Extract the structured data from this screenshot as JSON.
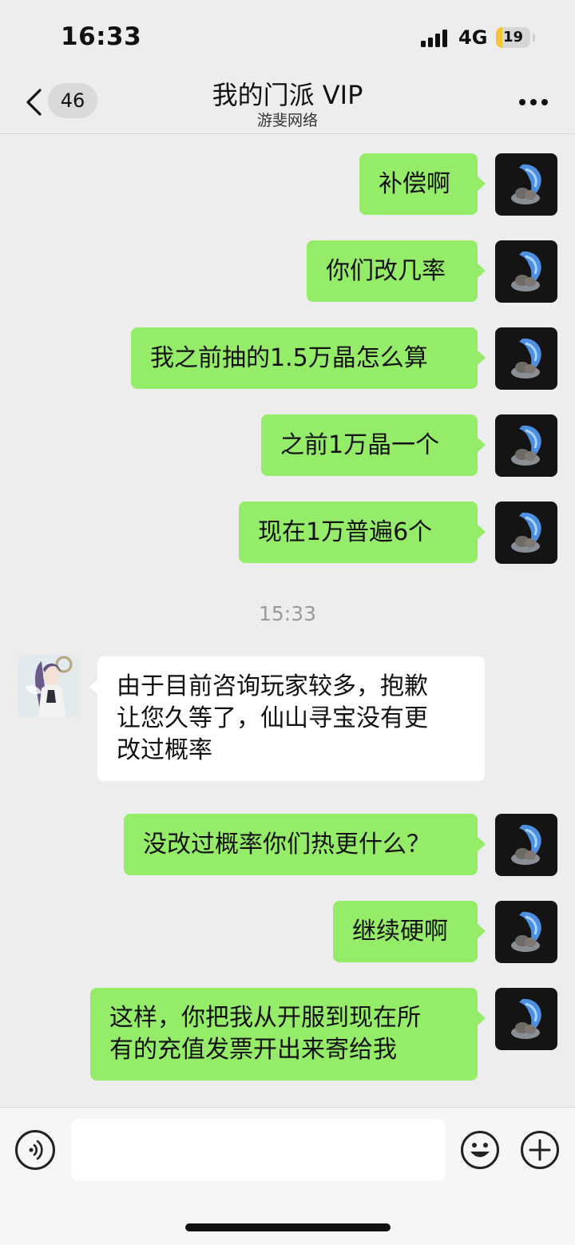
{
  "status_bar": {
    "time": "16:33",
    "network": "4G",
    "battery": "19"
  },
  "nav": {
    "unread_count": "46",
    "title": "我的门派 VIP",
    "subtitle": "游斐网络"
  },
  "messages": [
    {
      "side": "out",
      "text": "补偿啊"
    },
    {
      "side": "out",
      "text": "你们改几率"
    },
    {
      "side": "out",
      "text": "我之前抽的1.5万晶怎么算"
    },
    {
      "side": "out",
      "text": "之前1万晶一个"
    },
    {
      "side": "out",
      "text": "现在1万普遍6个"
    },
    {
      "side": "in",
      "lines": [
        "由于目前咨询玩家较多，抱歉",
        "让您久等了，仙山寻宝没有更",
        "改过概率"
      ]
    },
    {
      "side": "out",
      "text": "没改过概率你们热更什么？"
    },
    {
      "side": "out",
      "text": "继续硬啊"
    },
    {
      "side": "out",
      "lines": [
        "这样，你把我从开服到现在所",
        "有的充值发票开出来寄给我"
      ]
    }
  ],
  "timestamp": "15:33",
  "input_bar": {
    "text_value": ""
  },
  "colors": {
    "outgoing_bubble": "#95ec69",
    "incoming_bubble": "#ffffff",
    "background": "#ededed"
  }
}
